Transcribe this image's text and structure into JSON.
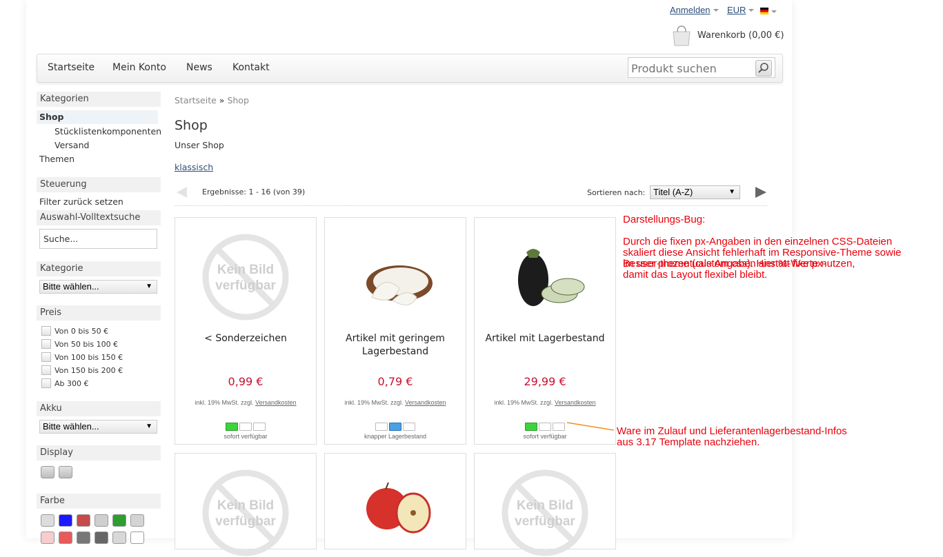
{
  "header": {
    "login": "Anmelden",
    "currency": "EUR",
    "cart": "Warenkorb (0,00 €)"
  },
  "nav": {
    "items": [
      "Startseite",
      "Mein Konto",
      "News",
      "Kontakt"
    ],
    "search_placeholder": "Produkt suchen"
  },
  "sidebar": {
    "categories_head": "Kategorien",
    "shop": "Shop",
    "sub1": "Stücklistenkomponenten",
    "sub2": "Versand",
    "themes": "Themen",
    "control_head": "Steuerung",
    "reset_filter": "Filter zurück setzen",
    "fulltext_head": "Auswahl-Volltextsuche",
    "fulltext_value": "Suche...",
    "kategorie_head": "Kategorie",
    "kategorie_select": "Bitte wählen...",
    "price_head": "Preis",
    "prices": [
      "Von 0 bis 50 €",
      "Von 50 bis 100 €",
      "Von 100 bis 150 €",
      "Von 150 bis 200 €",
      "Ab 300 €"
    ],
    "akku_head": "Akku",
    "akku_select": "Bitte wählen...",
    "display_head": "Display",
    "color_head": "Farbe",
    "colors": [
      "#dcdcdc",
      "#1a1aff",
      "#c94a4a",
      "#cfcfcf",
      "#2e9e2e",
      "#d4d4d4",
      "#f6cccc",
      "#e85a5a",
      "#777777",
      "#666666",
      "#d8d8d8",
      "#ffffff"
    ]
  },
  "main": {
    "breadcrumb_home": "Startseite",
    "breadcrumb_sep": "»",
    "breadcrumb_current": "Shop",
    "title": "Shop",
    "subtitle": "Unser Shop",
    "link_classic": "klassisch",
    "results": "Ergebnisse: 1 - 16 (von 39)",
    "sort_label": "Sortieren nach:",
    "sort_value": "Titel (A-Z)",
    "no_image_line1": "Kein Bild",
    "no_image_line2": "verfügbar"
  },
  "products": [
    {
      "name": "< Sonderzeichen",
      "price": "0,99 €",
      "tax": "inkl. 19% MwSt. zzgl.",
      "shipping": "Versandkosten",
      "stock": "sofort verfügbar",
      "stock_level": 3
    },
    {
      "name": "Artikel mit geringem Lagerbestand",
      "price": "0,79 €",
      "tax": "inkl. 19% MwSt. zzgl.",
      "shipping": "Versandkosten",
      "stock": "knapper Lagerbestand",
      "stock_level": 2
    },
    {
      "name": "Artikel mit Lagerbestand",
      "price": "29,99 €",
      "tax": "inkl. 19% MwSt. zzgl.",
      "shipping": "Versandkosten",
      "stock": "sofort verfügbar",
      "stock_level": 3
    }
  ],
  "notes": {
    "bug_title": "Darstellungs-Bug:",
    "bug_line1": "Durch die fixen px-Angaben in den einzelnen CSS-Dateien",
    "bug_line2": "skaliert diese Ansicht fehlerhaft im Responsive-Theme sowie",
    "bug_line3a": "im user-theme (custom.css). Hier %-Werte nutzen,",
    "bug_line3b": "Besser prozentuale Angaben anstatt fixe px-",
    "bug_line4": "damit das Layout flexibel bleibt.",
    "stock_line1": "Ware im Zulauf und Lieferantenlagerbestand-Infos",
    "stock_line2": "aus 3.17 Template nachziehen."
  }
}
